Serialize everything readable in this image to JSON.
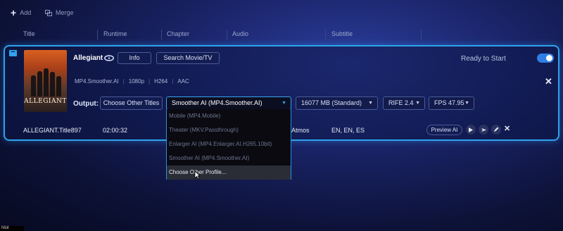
{
  "toolbar": {
    "add_label": "Add",
    "merge_label": "Merge"
  },
  "columns": [
    "Title",
    "Runtime",
    "Chapter",
    "Audio",
    "Subtitle"
  ],
  "title_item": {
    "name": "Allegiant",
    "info_label": "Info",
    "search_label": "Search Movie/TV",
    "status": "Ready to Start",
    "toggle_on": true,
    "poster_text": "ALLEGIANT",
    "specs": [
      "MP4.Smoother.AI",
      "1080p",
      "H264",
      "AAC"
    ]
  },
  "output": {
    "label": "Output:",
    "choose_titles_label": "Choose Other Titles",
    "profile_selected": "Smoother AI (MP4.Smoother.AI)",
    "size_selected": "16077 MB (Standard)",
    "rife_selected": "RIFE 2.4",
    "fps_selected": "FPS 47.95"
  },
  "profile_menu": [
    "Mobile (MP4.Mobile)",
    "Theater (MKV.Passthrough)",
    "Enlarger AI (MP4.Enlarger.AI.H265.10bit)",
    "Smoother AI (MP4.Smoother.AI)",
    "Choose Other Profile..."
  ],
  "row": {
    "title": "ALLEGIANT.Title897",
    "runtime": "02:00:32",
    "audio": "Atmos",
    "subtitle": "EN, EN, ES",
    "preview_label": "Preview AI"
  },
  "corner_text": "Nbit",
  "colors": {
    "accent": "#2fa3ec",
    "toggle": "#2f7fe6",
    "background": "#1a2468"
  }
}
